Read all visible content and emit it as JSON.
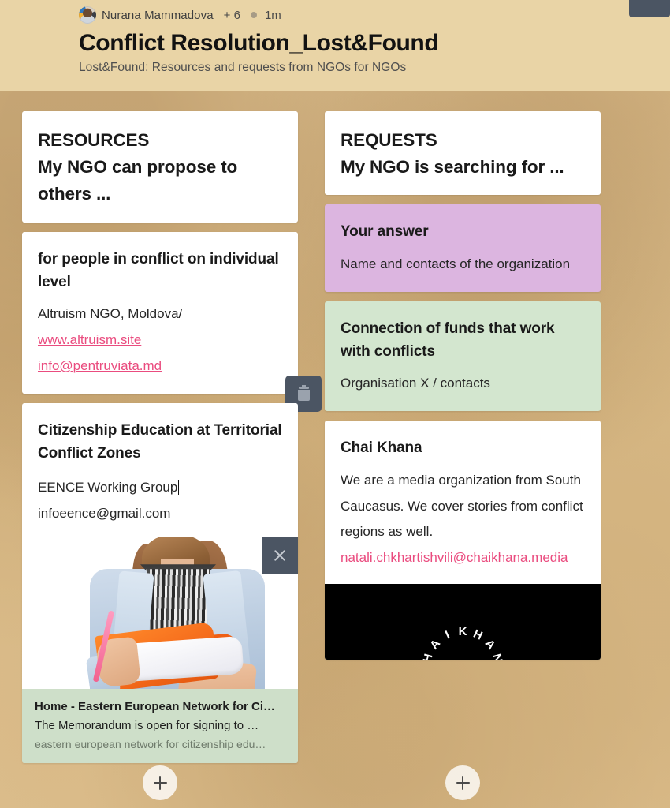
{
  "header": {
    "author": "Nurana Mammadova",
    "collaborators": "+ 6",
    "timestamp": "1m",
    "title": "Conflict Resolution_Lost&Found",
    "subtitle": "Lost&Found: Resources and requests from NGOs for NGOs",
    "background_color": "#e9d4a6"
  },
  "board": {
    "background_color": "#dcbd8b",
    "columns": [
      {
        "id": "resources",
        "header_card": {
          "line1": "RESOURCES",
          "line2": "My NGO can propose to others ..."
        },
        "add_button_label": "+",
        "cards": [
          {
            "id": "altruism",
            "color": "#ffffff",
            "title": "for people in conflict on individual level",
            "body": "Altruism NGO, Moldova/",
            "links": [
              "www.altruism.site",
              "info@pentruviata.md"
            ],
            "delete_button": "trash-icon"
          },
          {
            "id": "eence",
            "color": "#ffffff",
            "title": "Citizenship Education at Territorial Conflict Zones",
            "body_lines": [
              "EENCE Working Group",
              "infoeence@gmail.com"
            ],
            "has_caret": true,
            "close_button": "close-icon",
            "attachment": {
              "type": "image-link-preview",
              "image_alt": "person in denim shirt holding an orange notebook and pink pen",
              "preview_title": "Home - Eastern European Network for Ci…",
              "preview_description": "The Memorandum is open for signing to …",
              "preview_url": "eastern european network for citizenship edu…",
              "preview_color": "#cedfc9"
            }
          }
        ]
      },
      {
        "id": "requests",
        "header_card": {
          "line1": "REQUESTS",
          "line2": "My NGO is searching for ..."
        },
        "add_button_label": "+",
        "cards": [
          {
            "id": "your-answer",
            "color": "#dcb5e0",
            "title": "Your answer",
            "body": "Name and contacts of the organization"
          },
          {
            "id": "funds",
            "color": "#d3e6cf",
            "title": "Connection of funds that work with conflicts",
            "body": "Organisation X / contacts"
          },
          {
            "id": "chai-khana",
            "color": "#ffffff",
            "title": "Chai Khana",
            "body": "We are a media organization from South Caucasus. We cover stories from conflict regions as well.",
            "links": [
              "natali.chkhartishvili@chaikhana.media"
            ],
            "media": {
              "type": "image",
              "background": "#000000",
              "logo_text": "CHAIKHANA"
            }
          }
        ]
      }
    ]
  },
  "colors": {
    "link_pink": "#ea4c7f",
    "overlay_button": "#4b5563",
    "purple_card": "#dcb5e0",
    "green_card": "#d3e6cf",
    "preview_green": "#cedfc9"
  }
}
